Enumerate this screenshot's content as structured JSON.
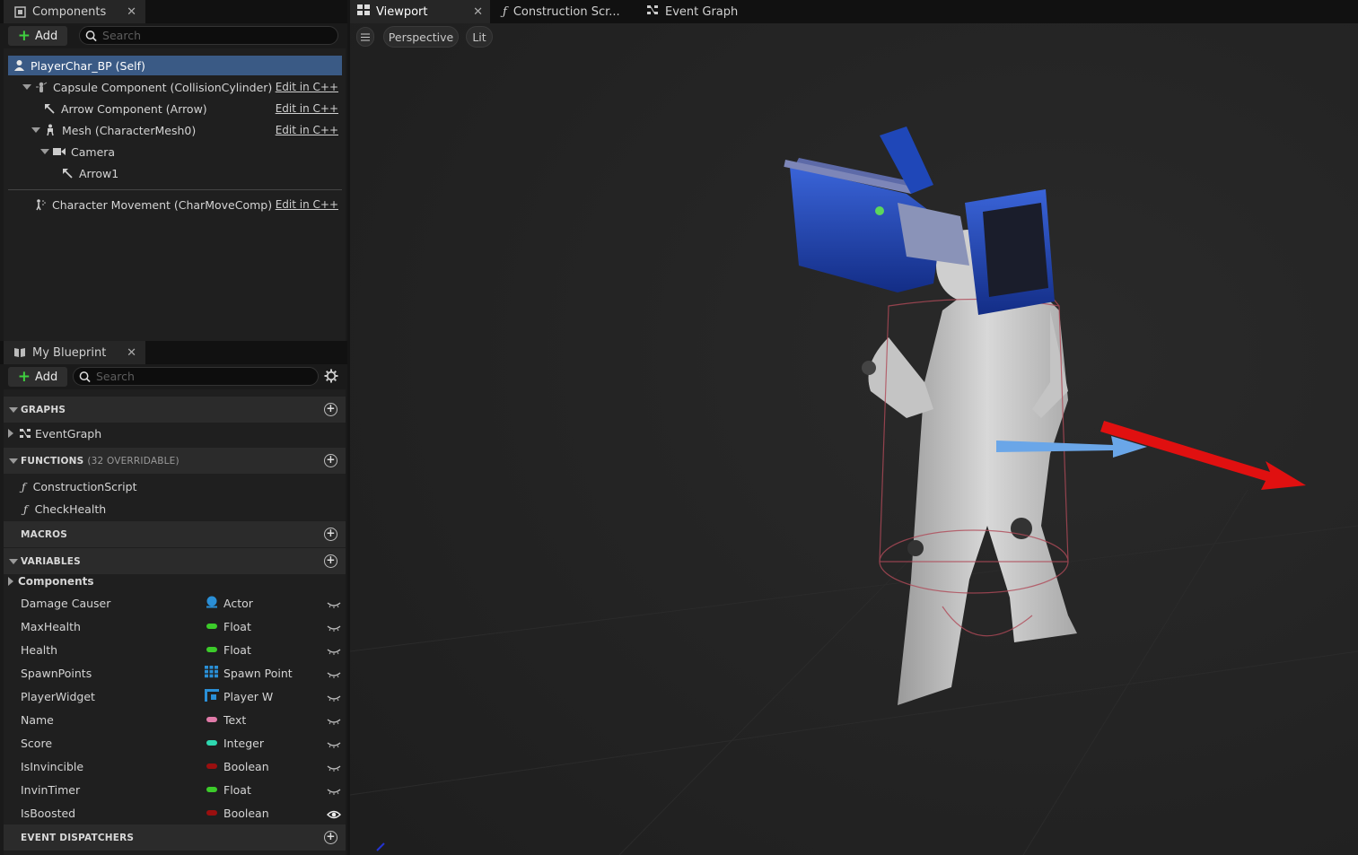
{
  "components_panel": {
    "tab_label": "Components",
    "add_label": "Add",
    "search_placeholder": "Search",
    "tree": [
      {
        "label": "PlayerChar_BP (Self)",
        "edit": ""
      },
      {
        "label": "Capsule Component (CollisionCylinder)",
        "edit": "Edit in C++"
      },
      {
        "label": "Arrow Component (Arrow)",
        "edit": "Edit in C++"
      },
      {
        "label": "Mesh (CharacterMesh0)",
        "edit": "Edit in C++"
      },
      {
        "label": "Camera",
        "edit": ""
      },
      {
        "label": "Arrow1",
        "edit": ""
      },
      {
        "label": "Character Movement (CharMoveComp)",
        "edit": "Edit in C++"
      }
    ]
  },
  "blueprint_panel": {
    "tab_label": "My Blueprint",
    "add_label": "Add",
    "search_placeholder": "Search",
    "sections": {
      "graphs": "GRAPHS",
      "functions": "FUNCTIONS",
      "functions_sub": "(32 OVERRIDABLE)",
      "macros": "MACROS",
      "variables": "VARIABLES",
      "event_dispatchers": "EVENT DISPATCHERS"
    },
    "graphs": [
      "EventGraph"
    ],
    "functions": [
      "ConstructionScript",
      "CheckHealth"
    ],
    "variable_category": "Components",
    "variables": [
      {
        "name": "Damage Causer",
        "type": "Actor",
        "color": "#2a8fd6"
      },
      {
        "name": "MaxHealth",
        "type": "Float",
        "color": "#3ccb2a"
      },
      {
        "name": "Health",
        "type": "Float",
        "color": "#3ccb2a"
      },
      {
        "name": "SpawnPoints",
        "type": "Spawn Point",
        "color": "#2a8fd6"
      },
      {
        "name": "PlayerWidget",
        "type": "Player W",
        "color": "#2a8fd6"
      },
      {
        "name": "Name",
        "type": "Text",
        "color": "#e07aa8"
      },
      {
        "name": "Score",
        "type": "Integer",
        "color": "#2ed8b0"
      },
      {
        "name": "IsInvincible",
        "type": "Boolean",
        "color": "#9a0f0f"
      },
      {
        "name": "InvinTimer",
        "type": "Float",
        "color": "#3ccb2a"
      },
      {
        "name": "IsBoosted",
        "type": "Boolean",
        "color": "#9a0f0f"
      }
    ]
  },
  "viewport": {
    "tabs": [
      "Viewport",
      "Construction Scr...",
      "Event Graph"
    ],
    "view_mode": "Perspective",
    "lighting": "Lit"
  },
  "colors": {
    "selection": "#3a5a85",
    "panel": "#1f1f1f",
    "viewport_bg": "#232323",
    "arrow_red": "#e01010",
    "arrow_blue": "#6aa6e8",
    "camera_blue": "#1f47b8"
  }
}
